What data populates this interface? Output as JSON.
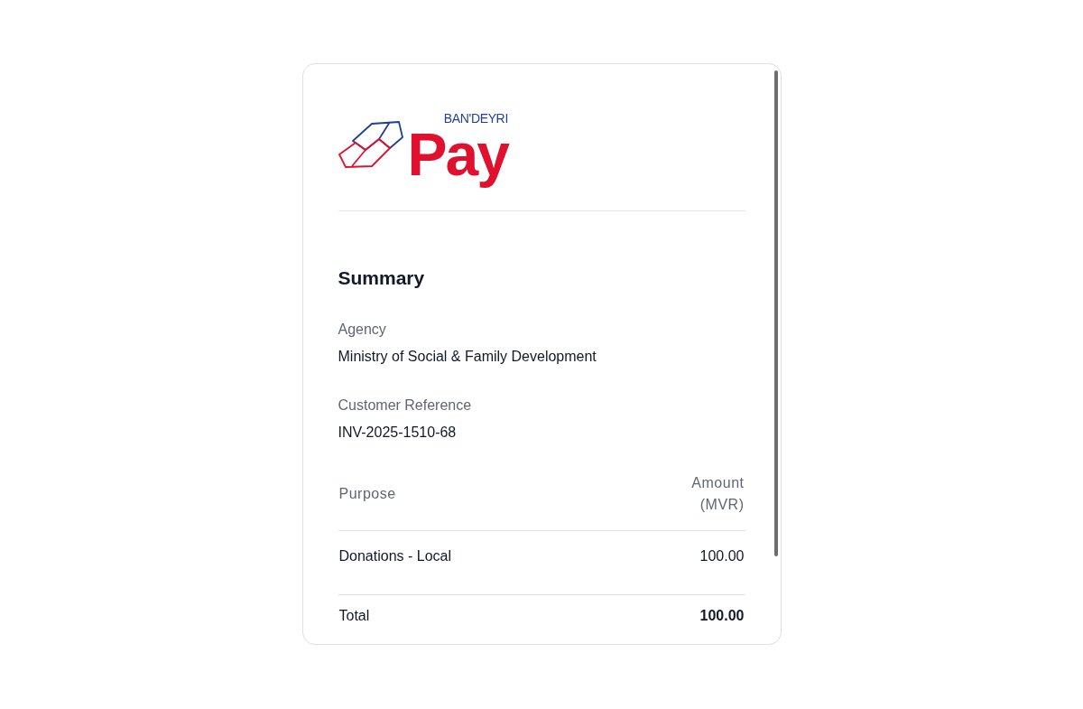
{
  "logo": {
    "tagline": "BAN'DEYRI",
    "wordmark": "Pay"
  },
  "summary": {
    "title": "Summary",
    "fields": [
      {
        "label": "Agency",
        "value": "Ministry of Social & Family Development"
      },
      {
        "label": "Customer Reference",
        "value": "INV-2025-1510-68"
      }
    ]
  },
  "table": {
    "columns": [
      "Purpose",
      "Amount (MVR)"
    ],
    "rows": [
      {
        "purpose": "Donations - Local",
        "amount": "100.00"
      }
    ],
    "total": {
      "label": "Total",
      "amount": "100.00"
    }
  }
}
